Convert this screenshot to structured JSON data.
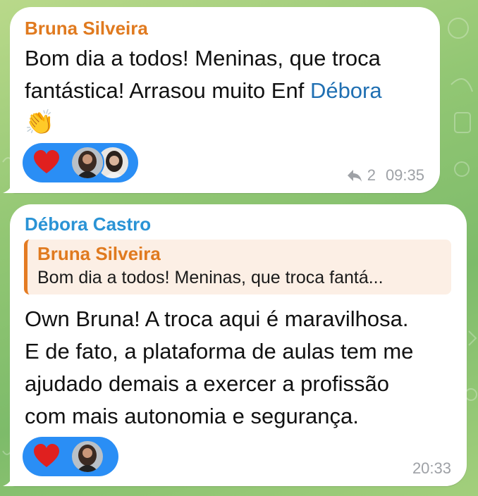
{
  "colors": {
    "sender_orange": "#e07a1f",
    "sender_blue": "#2a93d5",
    "mention_blue": "#1f6fb2",
    "reaction_blue": "#2a8ef5",
    "heart_red": "#e0201f",
    "quote_bg": "#fcefe5",
    "meta_gray": "#9ea1a6"
  },
  "messages": [
    {
      "sender": "Bruna Silveira",
      "text_part1": "Bom dia a todos! Meninas, que troca",
      "text_part2": "fantástica! Arrasou muito Enf ",
      "mention": "Débora",
      "emoji": "👏",
      "reactions": {
        "emoji": "heart-icon",
        "avatars": [
          "avatar-woman-1",
          "avatar-woman-2"
        ]
      },
      "reply_count": "2",
      "time": "09:35"
    },
    {
      "sender": "Débora Castro",
      "quote": {
        "sender": "Bruna Silveira",
        "text": "Bom dia a todos! Meninas, que troca fantá..."
      },
      "lines": [
        "Own Bruna! A troca aqui é maravilhosa.",
        "E de fato, a plataforma de aulas tem me",
        "ajudado demais a exercer a profissão",
        "com mais autonomia e segurança."
      ],
      "reactions": {
        "emoji": "heart-icon",
        "avatars": [
          "avatar-woman-1"
        ]
      },
      "time": "20:33"
    }
  ]
}
